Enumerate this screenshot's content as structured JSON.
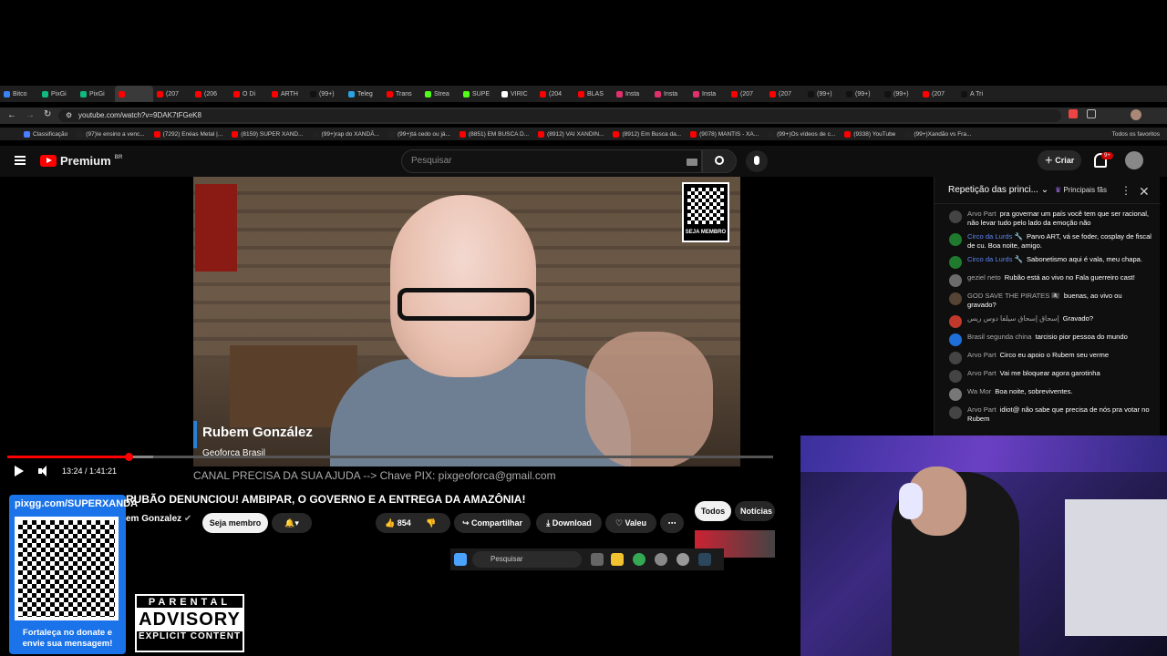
{
  "browser": {
    "tabs": [
      {
        "label": "Bitco",
        "color": "#3b82f6"
      },
      {
        "label": "PixGi",
        "color": "#10b981"
      },
      {
        "label": "PixGi",
        "color": "#10b981"
      },
      {
        "label": "",
        "color": "#ff0000",
        "active": true
      },
      {
        "label": "(207",
        "color": "#ff0000"
      },
      {
        "label": "(206",
        "color": "#ff0000"
      },
      {
        "label": "O Di",
        "color": "#ff0000"
      },
      {
        "label": "ARTH",
        "color": "#ff0000"
      },
      {
        "label": "(99+)",
        "color": "#111111"
      },
      {
        "label": "Teleg",
        "color": "#2aa3e0"
      },
      {
        "label": "Trans",
        "color": "#ff0000"
      },
      {
        "label": "Strea",
        "color": "#53fc18"
      },
      {
        "label": "SUPE",
        "color": "#53fc18"
      },
      {
        "label": "VIRIC",
        "color": "#ffffff"
      },
      {
        "label": "(204",
        "color": "#ff0000"
      },
      {
        "label": "BLAS",
        "color": "#ff0000"
      },
      {
        "label": "Insta",
        "color": "#e1306c"
      },
      {
        "label": "Insta",
        "color": "#e1306c"
      },
      {
        "label": "Insta",
        "color": "#e1306c"
      },
      {
        "label": "(207",
        "color": "#ff0000"
      },
      {
        "label": "(207",
        "color": "#ff0000"
      },
      {
        "label": "(99+)",
        "color": "#111111"
      },
      {
        "label": "(99+)",
        "color": "#111111"
      },
      {
        "label": "(99+)",
        "color": "#111111"
      },
      {
        "label": "(207",
        "color": "#ff0000"
      },
      {
        "label": "A Tri",
        "color": "#111111"
      }
    ],
    "url": "youtube.com/watch?v=9DAK7tFGeK8",
    "bookmarks": [
      "Classificação",
      "(97)Ie ensino a venc...",
      "(7292) Enéas Metal |...",
      "(8159) SUPER XAND...",
      "(99+)rap do XANDÃ...",
      "(99+)tá cedo ou já...",
      "(8851) EM BUSCA D...",
      "(8912) VAI XANDIN...",
      "(8912) Em Busca da...",
      "(9078) MANTIS - XA...",
      "(99+)Os vídeos de c...",
      "(9338) YouTube",
      "(99+)Xandão vs Fra..."
    ],
    "all_bookmarks": "Todos os favoritos"
  },
  "youtube": {
    "logo_text": "Premium",
    "logo_region": "BR",
    "search_placeholder": "Pesquisar",
    "create_label": "Criar",
    "notif_count": "9+"
  },
  "video": {
    "qr_label": "SEJA MEMBRO",
    "lower_third_name": "Rubem González",
    "lower_third_org": "Geoforça Brasil",
    "pix_line": "CANAL PRECISA DA SUA AJUDA --> Chave PIX: pixgeoforca@gmail.com",
    "time": "13:24 / 1:41:21",
    "progress": 0.158,
    "buffered": 0.19
  },
  "meta": {
    "title": "RUBÃO DENUNCIOU! AMBIPAR, O GOVERNO E A ENTREGA DA AMAZÔNIA!",
    "channel": "em Gonzalez",
    "member_label": "Seja membro",
    "likes": "854",
    "share_label": "Compartilhar",
    "download_label": "Download",
    "thanks_label": "Valeu",
    "filter_all": "Todos",
    "filter_news": "Notícias r"
  },
  "taskbar": {
    "search_placeholder": "Pesquisar"
  },
  "chat": {
    "title": "Repetição das princi...",
    "fans_label": "Principais fãs",
    "messages": [
      {
        "author": "Arvo Part",
        "text": "pra governar um país você tem que ser racional, não levar tudo pelo lado da emoção não",
        "avatar": "#444444",
        "mod": false
      },
      {
        "author": "Circo da Lurds 🔧",
        "text": "Parvo ART, vá se foder, cosplay de fiscal de cu. Boa noite, amigo.",
        "avatar": "#1f7a2e",
        "mod": true
      },
      {
        "author": "Circo da Lurds 🔧",
        "text": "Sabonetismo aqui é vala, meu chapa.",
        "avatar": "#1f7a2e",
        "mod": true
      },
      {
        "author": "geziel neto",
        "text": "Rubão está ao vivo no Fala guerreiro cast!",
        "avatar": "#6b6b6b",
        "mod": false
      },
      {
        "author": "GOD SAVE THE PIRATES 🏴‍☠️",
        "text": "buenas, ao vivo ou gravado?",
        "avatar": "#554433",
        "mod": false
      },
      {
        "author": "إسحاق إسحاق سيلفا دوس ريس",
        "text": "Gravado?",
        "avatar": "#c0392b",
        "mod": false
      },
      {
        "author": "Brasil segunda china",
        "text": "tarcisio pior pessoa do mundo",
        "avatar": "#1e6fd9",
        "mod": false
      },
      {
        "author": "Arvo Part",
        "text": "Circo eu apoio o Rubem seu verme",
        "avatar": "#444444",
        "mod": false
      },
      {
        "author": "Arvo Part",
        "text": "Vai me bloquear agora garotinha",
        "avatar": "#444444",
        "mod": false
      },
      {
        "author": "Wa Mor",
        "text": "Boa noite, sobreviventes.",
        "avatar": "#777777",
        "mod": false
      },
      {
        "author": "Arvo Part",
        "text": "idiot@ não sabe que precisa de nós pra votar no Rubem",
        "avatar": "#444444",
        "mod": false
      }
    ]
  },
  "overlays": {
    "pix_url": "pixgg.com/SUPERXANDÃ",
    "pix_message": "Fortaleça no donate e envie sua mensagem!",
    "advisory_top": "PARENTAL",
    "advisory_mid": "ADVISORY",
    "advisory_bottom": "EXPLICIT CONTENT"
  },
  "colors": {
    "youtube_red": "#ff0000",
    "pix_blue": "#1a73e8",
    "mod_name": "#5e84f1"
  }
}
